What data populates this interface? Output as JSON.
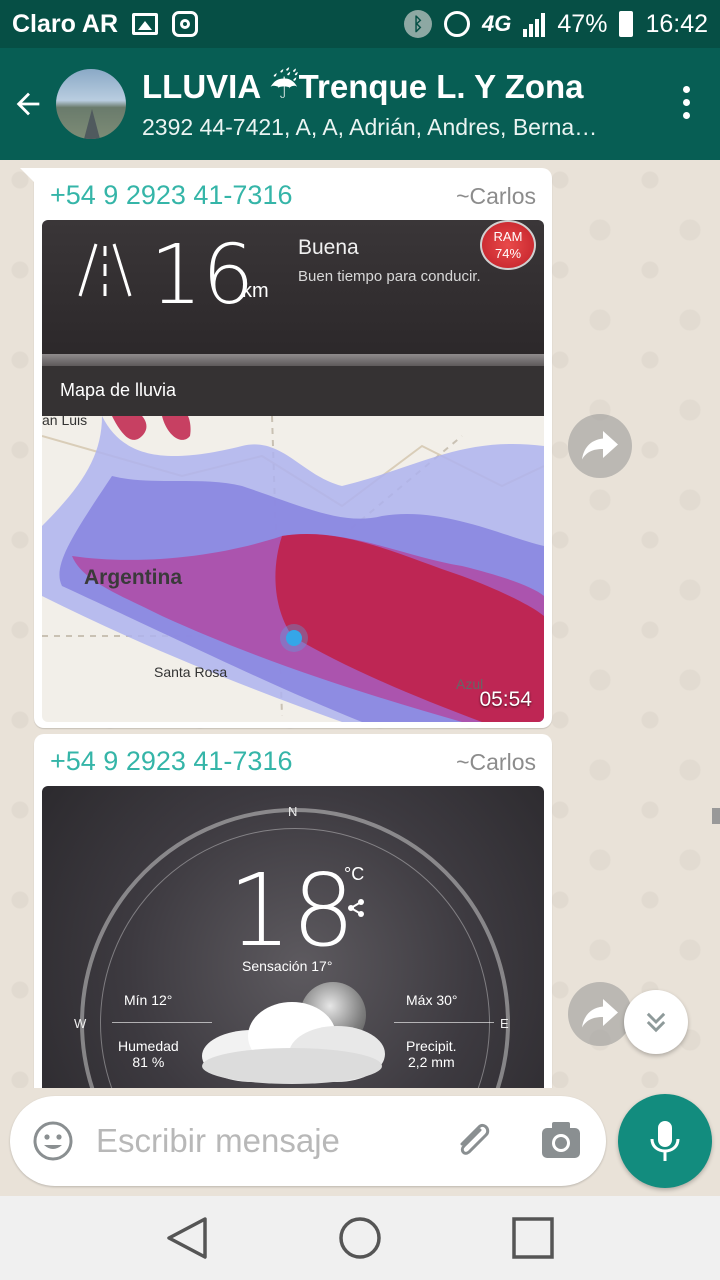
{
  "status_bar": {
    "carrier": "Claro AR",
    "network": "4G",
    "battery": "47%",
    "time": "16:42"
  },
  "header": {
    "title": "LLUVIA ☔Trenque L. Y Zona",
    "members": "2392 44-7421, A, A, Adrián, Andres, Berna…"
  },
  "messages": [
    {
      "sender_phone": "+54 9 2923 41-7316",
      "sender_name": "~Carlos",
      "time": "05:54",
      "media": {
        "distance": "16",
        "distance_unit": "km",
        "condition_title": "Buena",
        "condition_subtitle": "Buen tiempo para conducir.",
        "ram_label": "RAM",
        "ram_value": "74%",
        "map_title": "Mapa de lluvia",
        "map_labels": {
          "country": "Argentina",
          "city_1": "Santa Rosa",
          "city_2": "an Luis",
          "city_3": "Azul"
        }
      }
    },
    {
      "sender_phone": "+54 9 2923 41-7316",
      "sender_name": "~Carlos",
      "media": {
        "temperature": "18",
        "temp_unit": "°C",
        "feels_like": "Sensación 17°",
        "min_temp": "Mín 12°",
        "max_temp": "Máx 30°",
        "humidity_label": "Humedad",
        "humidity_value": "81 %",
        "precip_label": "Precipit.",
        "precip_value": "2,2 mm",
        "compass_n": "N",
        "compass_w": "W",
        "compass_e": "E"
      }
    }
  ],
  "composer": {
    "placeholder": "Escribir mensaje"
  },
  "icons": {
    "back": "arrow-left-icon",
    "menu": "more-vert-icon",
    "forward": "forward-icon",
    "scroll": "chevron-double-down-icon",
    "emoji": "emoji-icon",
    "attach": "paperclip-icon",
    "camera": "camera-icon",
    "mic": "mic-icon",
    "nav_back": "triangle-back-icon",
    "nav_home": "circle-home-icon",
    "nav_recents": "square-recents-icon"
  },
  "colors": {
    "status_bar": "#064f45",
    "header": "#075e54",
    "accent": "#128c7e",
    "sender": "#35b5a8",
    "chat_bg": "#e9e2d8"
  }
}
